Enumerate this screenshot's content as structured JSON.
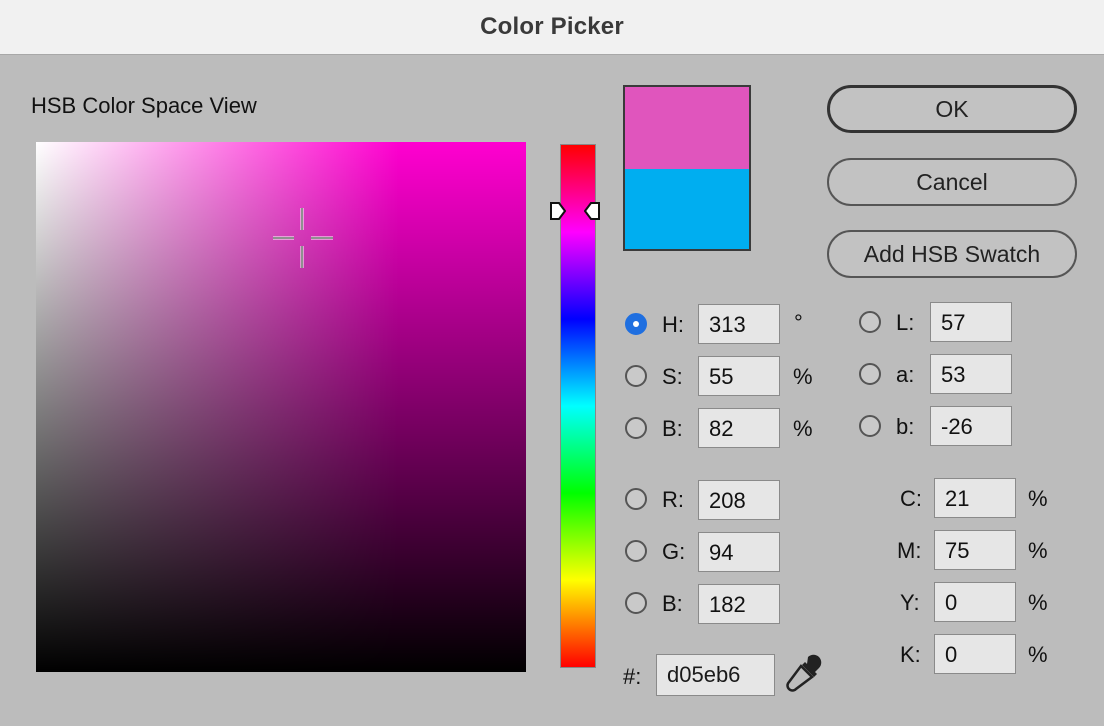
{
  "window": {
    "title": "Color Picker"
  },
  "view_label": "HSB Color Space View",
  "colors": {
    "new_color": "#e055bd",
    "original_color": "#00aef0",
    "field_hue_color": "#ff00d0"
  },
  "buttons": {
    "ok": "OK",
    "cancel": "Cancel",
    "add_swatch": "Add HSB Swatch"
  },
  "hsb": {
    "h": {
      "label": "H:",
      "value": "313",
      "unit": "°",
      "selected": true
    },
    "s": {
      "label": "S:",
      "value": "55",
      "unit": "%",
      "selected": false
    },
    "b": {
      "label": "B:",
      "value": "82",
      "unit": "%",
      "selected": false
    }
  },
  "rgb": {
    "r": {
      "label": "R:",
      "value": "208",
      "selected": false
    },
    "g": {
      "label": "G:",
      "value": "94",
      "selected": false
    },
    "b": {
      "label": "B:",
      "value": "182",
      "selected": false
    }
  },
  "lab": {
    "l": {
      "label": "L:",
      "value": "57",
      "selected": false
    },
    "a": {
      "label": "a:",
      "value": "53",
      "selected": false
    },
    "b": {
      "label": "b:",
      "value": "-26",
      "selected": false
    }
  },
  "cmyk": {
    "c": {
      "label": "C:",
      "value": "21",
      "unit": "%"
    },
    "m": {
      "label": "M:",
      "value": "75",
      "unit": "%"
    },
    "y": {
      "label": "Y:",
      "value": "0",
      "unit": "%"
    },
    "k": {
      "label": "K:",
      "value": "0",
      "unit": "%"
    }
  },
  "hex": {
    "label": "#:",
    "value": "d05eb6"
  },
  "icons": {
    "crosshair": "crosshair-icon",
    "hue_marker": "triangle-marker-icon",
    "eyedropper": "eyedropper-icon"
  }
}
